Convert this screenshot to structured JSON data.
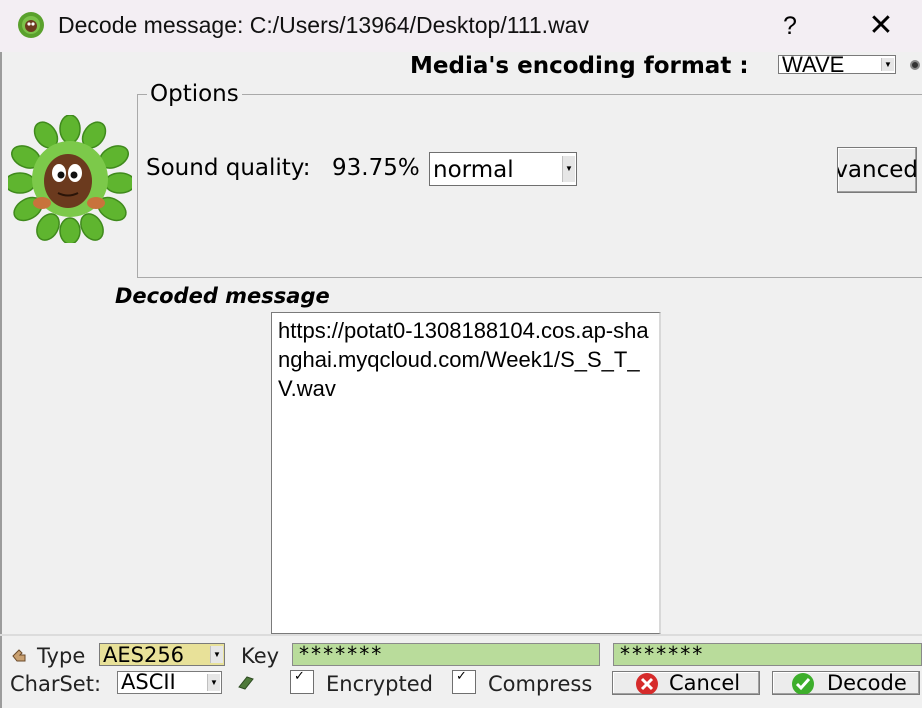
{
  "window": {
    "title": "Decode message: C:/Users/13964/Desktop/111.wav",
    "help_glyph": "?",
    "close_glyph": "✕"
  },
  "format": {
    "label": "Media's encoding format :",
    "value": "WAVE"
  },
  "options": {
    "legend": "Options",
    "sound_quality_label": "Sound quality:",
    "sound_quality_value": "93.75%",
    "quality_mode": "normal",
    "advanced_button": "Advanced"
  },
  "decoded": {
    "label": "Decoded message",
    "text": "https://potat0-1308188104.cos.ap-shanghai.myqcloud.com/Week1/S_S_T_V.wav"
  },
  "bottom": {
    "type_label": "Type",
    "type_value": "AES256",
    "key_label": "Key",
    "key_value": "*******",
    "key_confirm_value": "*******",
    "charset_label": "CharSet:",
    "charset_value": "ASCII",
    "encrypted_label": "Encrypted",
    "compress_label": "Compress",
    "cancel_label": "Cancel",
    "decode_label": "Decode"
  },
  "colors": {
    "key_field_bg": "#b9dc9b",
    "type_field_bg": "#e8e199",
    "cancel_icon": "#d62b2b",
    "decode_icon": "#3dae2b"
  },
  "icons": {
    "app": "leaf-face-icon",
    "help": "question-icon",
    "close": "close-icon",
    "avatar": "leaf-character-icon",
    "type": "hand-pointer-icon",
    "charset": "book-icon",
    "cancel": "cancel-x-icon",
    "decode": "check-icon"
  }
}
